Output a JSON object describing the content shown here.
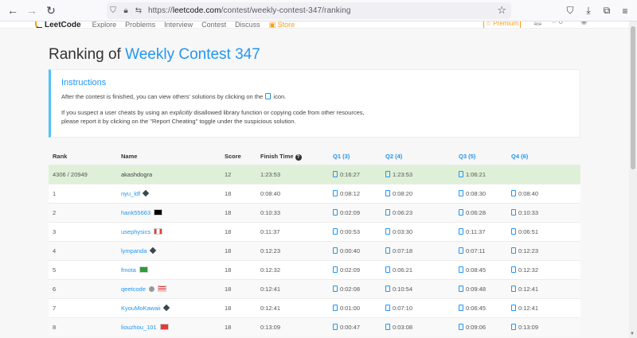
{
  "browser": {
    "url_prefix": "https://",
    "url_domain": "leetcode.com",
    "url_path": "/contest/weekly-contest-347/ranking"
  },
  "site_nav": {
    "logo": "LeetCode",
    "links": [
      "Explore",
      "Problems",
      "Interview",
      "Contest",
      "Discuss",
      "Store"
    ],
    "premium": "☆ Premium",
    "points": "0"
  },
  "page": {
    "title_prefix": "Ranking of ",
    "contest_name": "Weekly Contest 347"
  },
  "instructions": {
    "title": "Instructions",
    "p1_before": "After the contest is finished, you can view others' solutions by clicking on the",
    "p1_after": "icon.",
    "p2_a": "If you suspect a user cheats by using an ",
    "p2_em": "explicitly",
    "p2_b": " disallowed library function or copying code from other resources,",
    "p2_c": "please report it by clicking on the \"Report Cheating\" toggle under the suspicious solution."
  },
  "table": {
    "headers": {
      "rank": "Rank",
      "name": "Name",
      "score": "Score",
      "finish": "Finish Time",
      "q1": "Q1 (3)",
      "q2": "Q2 (4)",
      "q3": "Q3 (5)",
      "q4": "Q4 (6)"
    },
    "rows": [
      {
        "rank": "4306 / 20949",
        "name": "akashdogra",
        "badge": "",
        "score": "12",
        "finish": "1:23:53",
        "q1": "0:16:27",
        "q2": "1:23:53",
        "q3": "1:06:21",
        "q4": ""
      },
      {
        "rank": "1",
        "name": "nyu_ldf",
        "badge": "cube",
        "score": "18",
        "finish": "0:08:40",
        "q1": "0:08:12",
        "q2": "0:08:20",
        "q3": "0:08:30",
        "q4": "0:08:40"
      },
      {
        "rank": "2",
        "name": "hank55663",
        "badge": "tw",
        "score": "18",
        "finish": "0:10:33",
        "q1": "0:02:09",
        "q2": "0:06:23",
        "q3": "0:06:28",
        "q4": "0:10:33"
      },
      {
        "rank": "3",
        "name": "usephysics",
        "badge": "ca",
        "score": "18",
        "finish": "0:11:37",
        "q1": "0:00:53",
        "q2": "0:03:30",
        "q3": "0:11:37",
        "q4": "0:06:51"
      },
      {
        "rank": "4",
        "name": "lympanda",
        "badge": "cube",
        "score": "18",
        "finish": "0:12:23",
        "q1": "0:00:40",
        "q2": "0:07:18",
        "q3": "0:07:11",
        "q4": "0:12:23"
      },
      {
        "rank": "5",
        "name": "fmota",
        "badge": "br",
        "score": "18",
        "finish": "0:12:32",
        "q1": "0:02:09",
        "q2": "0:06:21",
        "q3": "0:08:45",
        "q4": "0:12:32"
      },
      {
        "rank": "6",
        "name": "qeetcode",
        "badge": "us",
        "score": "18",
        "finish": "0:12:41",
        "q1": "0:02:08",
        "q2": "0:10:54",
        "q3": "0:09:48",
        "q4": "0:12:41"
      },
      {
        "rank": "7",
        "name": "KyouMoKawaii",
        "badge": "cube",
        "score": "18",
        "finish": "0:12:41",
        "q1": "0:01:00",
        "q2": "0:07:10",
        "q3": "0:06:45",
        "q4": "0:12:41"
      },
      {
        "rank": "8",
        "name": "liouzhou_101",
        "badge": "cn",
        "score": "18",
        "finish": "0:13:09",
        "q1": "0:00:47",
        "q2": "0:03:08",
        "q3": "0:09:06",
        "q4": "0:13:09"
      }
    ]
  }
}
